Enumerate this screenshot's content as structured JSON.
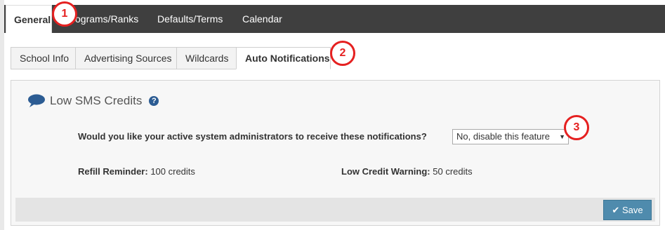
{
  "topnav": {
    "tabs": [
      {
        "label": "General",
        "active": true
      },
      {
        "label": "ograms/Ranks",
        "active": false
      },
      {
        "label": "Defaults/Terms",
        "active": false
      },
      {
        "label": "Calendar",
        "active": false
      }
    ]
  },
  "subtabs": [
    {
      "label": "School Info",
      "active": false
    },
    {
      "label": "Advertising Sources",
      "active": false
    },
    {
      "label": "Wildcards",
      "active": false
    },
    {
      "label": "Auto Notifications",
      "active": true
    }
  ],
  "panel": {
    "title": "Low SMS Credits",
    "title_icon": "speech-bubble-icon",
    "help_icon": "question-circle-icon",
    "help_glyph": "?",
    "question": "Would you like your active system administrators to receive these notifications?",
    "select_value": "No, disable this feature",
    "refill_label": "Refill Reminder:",
    "refill_value": "100 credits",
    "warning_label": "Low Credit Warning:",
    "warning_value": "50 credits",
    "save_label": "Save"
  },
  "callouts": [
    "1",
    "2",
    "3"
  ],
  "colors": {
    "nav_bg": "#3f3f3f",
    "accent": "#2c5c93",
    "save_bg": "#4f8bad",
    "callout_red": "#e52020"
  }
}
